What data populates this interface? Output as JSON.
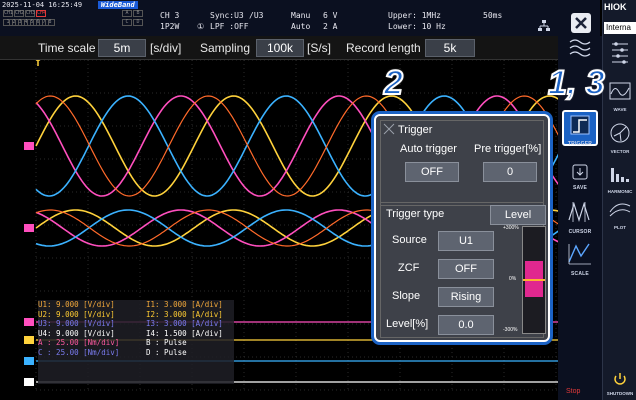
{
  "status": {
    "datetime": "2025-11-04 16:25:49",
    "badge": "WideBand",
    "channel_label": "CH 3",
    "wiring": "1P2W",
    "sync": "Sync:U3",
    "sync_div": "/U3",
    "lpf_num": "①",
    "lpf": "LPF :OFF",
    "range_mode": "Manu",
    "range_mode2": "Auto",
    "voltage_range": "6 V",
    "current_range": "2 A",
    "upper": "Upper:  1MHz",
    "lower": "Lower: 10 Hz",
    "period": "50ms",
    "ch_top": [
      "CH1",
      "CH2",
      "CH3",
      "CH4"
    ],
    "ch_bot": [
      "1",
      "2",
      "3",
      "4",
      "5",
      "6",
      "7",
      "8"
    ],
    "ab": [
      "A",
      "B"
    ],
    "cd": [
      "C",
      "D"
    ]
  },
  "timebar": {
    "time_scale_label": "Time scale",
    "time_scale_value": "5m",
    "time_scale_unit": "[s/div]",
    "sampling_label": "Sampling",
    "sampling_value": "100k",
    "sampling_unit": "[S/s]",
    "record_label": "Record length",
    "record_value": "5k"
  },
  "legend": {
    "rows": [
      {
        "left": "U1: 9.000  [V/div]",
        "right": "I1: 3.000 [A/div]",
        "lc": "#f2a93b",
        "rc": "#f2a93b"
      },
      {
        "left": "U2: 9.000  [V/div]",
        "right": "I2: 3.000 [A/div]",
        "lc": "#ffcc33",
        "rc": "#ffcc33"
      },
      {
        "left": "U3: 9.000  [V/div]",
        "right": "I3: 3.000 [A/div]",
        "lc": "#7b7cf0",
        "rc": "#7b7cf0"
      },
      {
        "left": "U4: 9.000  [V/div]",
        "right": "I4: 1.500 [A/div]",
        "lc": "#ffffff",
        "rc": "#ffffff"
      },
      {
        "left": "A : 25.00  [Nm/div]",
        "right": "B : Pulse",
        "lc": "#ff5aa0",
        "rc": "#ffffff"
      },
      {
        "left": "C : 25.00  [Nm/div]",
        "right": "D : Pulse",
        "lc": "#7b7cf0",
        "rc": "#ffffff"
      }
    ]
  },
  "trigger": {
    "title": "Trigger",
    "auto_label": "Auto trigger",
    "pre_label": "Pre trigger[%]",
    "auto_value": "OFF",
    "pre_value": "0",
    "type_label": "Trigger type",
    "type_value": "Level",
    "source_label": "Source",
    "source_value": "U1",
    "zcf_label": "ZCF",
    "zcf_value": "OFF",
    "slope_label": "Slope",
    "slope_value": "Rising",
    "level_label": "Level[%]",
    "level_value": "0.0",
    "gauge_top": "+300%",
    "gauge_mid": "0%",
    "gauge_bot": "-300%"
  },
  "tools": [
    {
      "name": "TRIGGER"
    },
    {
      "name": "SAVE"
    },
    {
      "name": "CURSOR"
    },
    {
      "name": "SCALE"
    }
  ],
  "side": {
    "brand": "HIOK",
    "internal": "Interna",
    "items": [
      "WAVE",
      "VECTOR",
      "HARMONIC",
      "PLOT",
      "SHUTDOWN"
    ]
  },
  "callouts": {
    "left": "2",
    "right": "1, 3"
  },
  "stop_text": "Stop",
  "colors": {
    "u1": "#ff6a2a",
    "u2": "#ffd23c",
    "u3": "#3bb2ff",
    "pink": "#ff4fbe",
    "accent": "#1b62c4"
  }
}
